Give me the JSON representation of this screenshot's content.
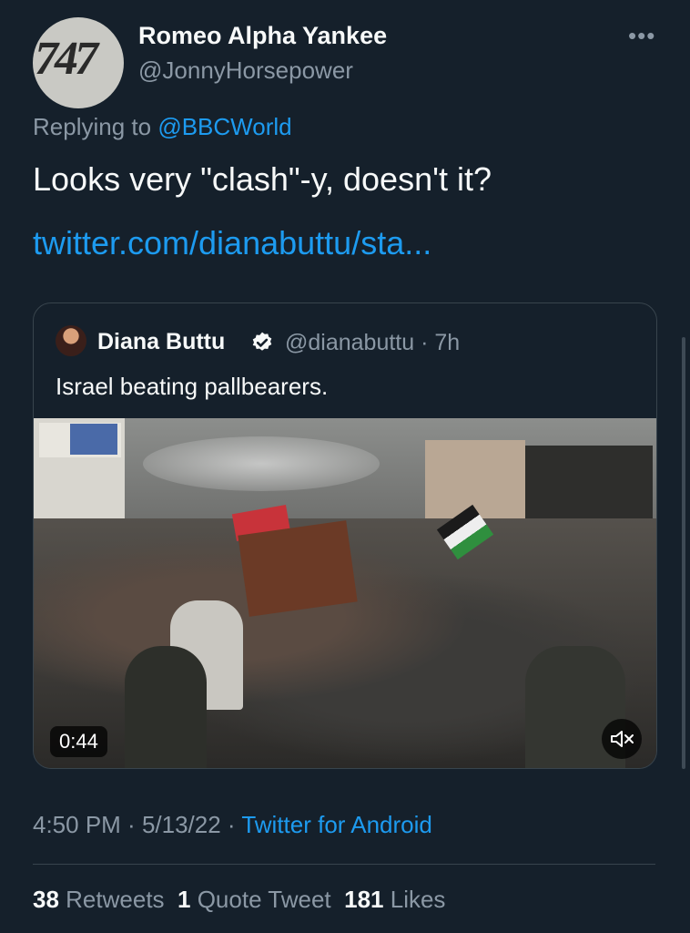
{
  "tweet": {
    "avatar_text": "747",
    "display_name": "Romeo Alpha Yankee",
    "handle": "@JonnyHorsepower",
    "replying_prefix": "Replying to ",
    "replying_to": "@BBCWorld",
    "text": "Looks very \"clash\"-y, doesn't it?",
    "link": "twitter.com/dianabuttu/sta...",
    "time": "4:50 PM",
    "date": "5/13/22",
    "source": "Twitter for Android",
    "stats": {
      "retweets_count": "38",
      "retweets_label": "Retweets",
      "quotes_count": "1",
      "quotes_label": "Quote Tweet",
      "likes_count": "181",
      "likes_label": "Likes"
    }
  },
  "quoted": {
    "name": "Diana Buttu",
    "handle_time": "@dianabuttu · 7h",
    "text": "Israel beating pallbearers.",
    "video_duration": "0:44"
  },
  "icons": {
    "more": "more-horizontal-icon",
    "verified": "verified-badge-icon",
    "mute": "speaker-muted-icon"
  },
  "colors": {
    "background": "#15202b",
    "accent": "#1d9bf0",
    "secondary_text": "#8b98a5"
  }
}
